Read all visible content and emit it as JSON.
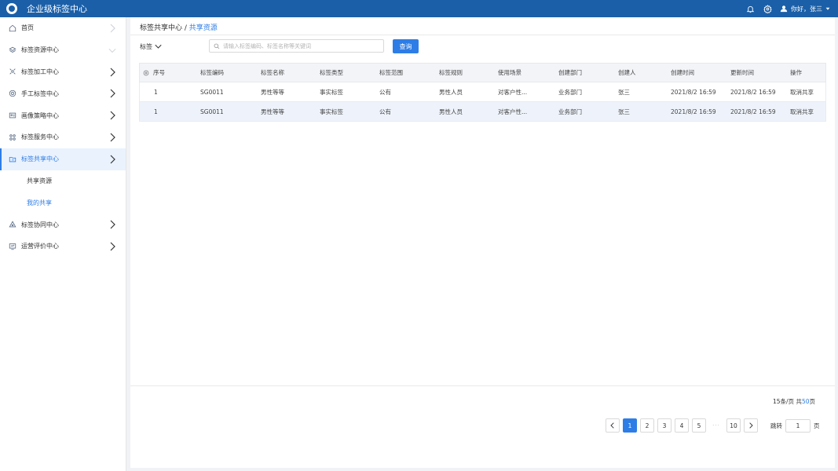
{
  "header": {
    "app_title": "企业级标签中心",
    "user_greeting": "你好，张三"
  },
  "sidebar": {
    "items": [
      {
        "label": "首页",
        "icon": "home-icon"
      },
      {
        "label": "标签资源中心",
        "icon": "layers-icon"
      },
      {
        "label": "标签加工中心",
        "icon": "process-icon"
      },
      {
        "label": "手工标签中心",
        "icon": "gear-icon"
      },
      {
        "label": "画像策略中心",
        "icon": "portrait-icon"
      },
      {
        "label": "标签服务中心",
        "icon": "grid-icon"
      },
      {
        "label": "标签共享中心",
        "icon": "share-folder-icon"
      },
      {
        "label": "标签协同中心",
        "icon": "collab-icon"
      },
      {
        "label": "运营评价中心",
        "icon": "monitor-icon"
      }
    ],
    "subitems": [
      {
        "label": "共享资源"
      },
      {
        "label": "我的共享"
      }
    ]
  },
  "breadcrumb": {
    "parent": "标签共享中心",
    "separator": " / ",
    "current": "共享资源"
  },
  "filter": {
    "type_label": "标签",
    "search_placeholder": "请输入标签编码、标签名称等关键词",
    "query_label": "查询"
  },
  "table": {
    "headers": [
      "序号",
      "标签编码",
      "标签名称",
      "标签类型",
      "标签范围",
      "标签规则",
      "使用场景",
      "创建部门",
      "创建人",
      "创建时间",
      "更新时间",
      "操作"
    ],
    "rows": [
      {
        "idx": "1",
        "code": "SG0011",
        "name": "男性等等",
        "type": "事实标签",
        "range": "公有",
        "rule": "男性人员",
        "scene": "对客户性...",
        "dept": "业务部门",
        "creator": "张三",
        "ctime": "2021/8/2 16:59",
        "utime": "2021/8/2 16:59",
        "op": "取消共享"
      },
      {
        "idx": "1",
        "code": "SG0011",
        "name": "男性等等",
        "type": "事实标签",
        "range": "公有",
        "rule": "男性人员",
        "scene": "对客户性...",
        "dept": "业务部门",
        "creator": "张三",
        "ctime": "2021/8/2 16:59",
        "utime": "2021/8/2 16:59",
        "op": "取消共享"
      }
    ]
  },
  "pagination": {
    "per_page": "15条/页",
    "total_prefix": "共",
    "total_pages": "50",
    "total_suffix": "页",
    "pages": [
      "1",
      "2",
      "3",
      "4",
      "5"
    ],
    "ellipsis": "···",
    "last_page": "10",
    "jump_label": "跳转",
    "jump_value": "1",
    "jump_suffix": "页"
  },
  "colors": {
    "header_bg": "#1a5fa8",
    "accent": "#2e7de6",
    "row_alt": "#eef3fb"
  }
}
